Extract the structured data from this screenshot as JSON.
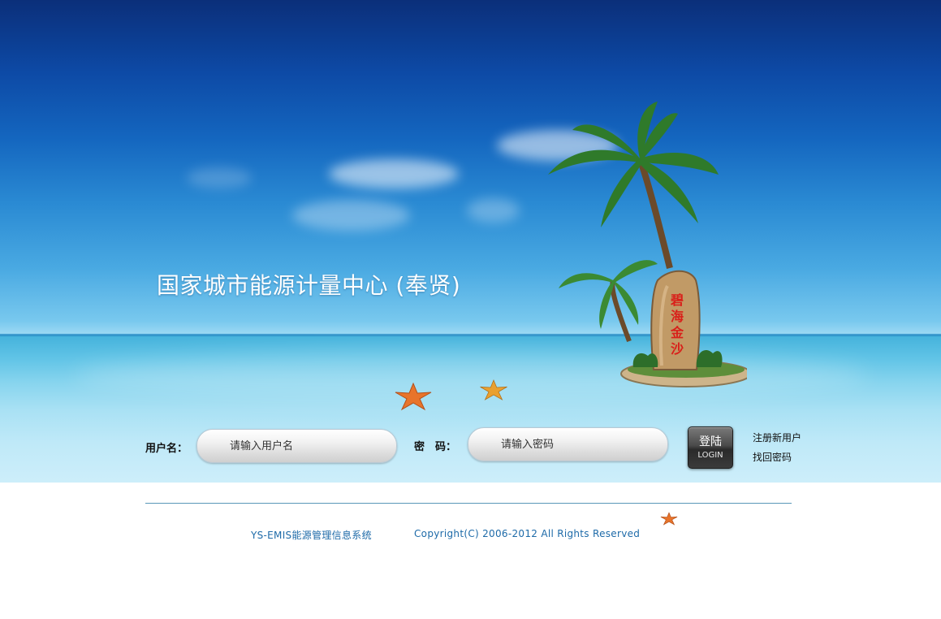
{
  "header": {
    "title": "国家城市能源计量中心 (奉贤)",
    "rock_inscription": [
      "碧",
      "海",
      "金",
      "沙"
    ]
  },
  "login_form": {
    "username_label": "用户名：",
    "username_placeholder": "请输入用户名",
    "username_value": "",
    "password_label": "密　码：",
    "password_placeholder": "请输入密码",
    "password_value": "",
    "login_button_main": "登陆",
    "login_button_sub": "LOGIN",
    "register_link": "注册新用户",
    "forgot_password_link": "找回密码"
  },
  "footer": {
    "system_name": "YS-EMIS能源管理信息系统",
    "copyright": "Copyright(C) 2006-2012 All Rights Reserved"
  },
  "colors": {
    "sky_dark": "#0b2f7a",
    "sea": "#45b3dc",
    "footer_text": "#1d6aa8",
    "starfish": "#e8742b"
  },
  "icons": [
    "starfish-icon",
    "palm-tree-island"
  ]
}
